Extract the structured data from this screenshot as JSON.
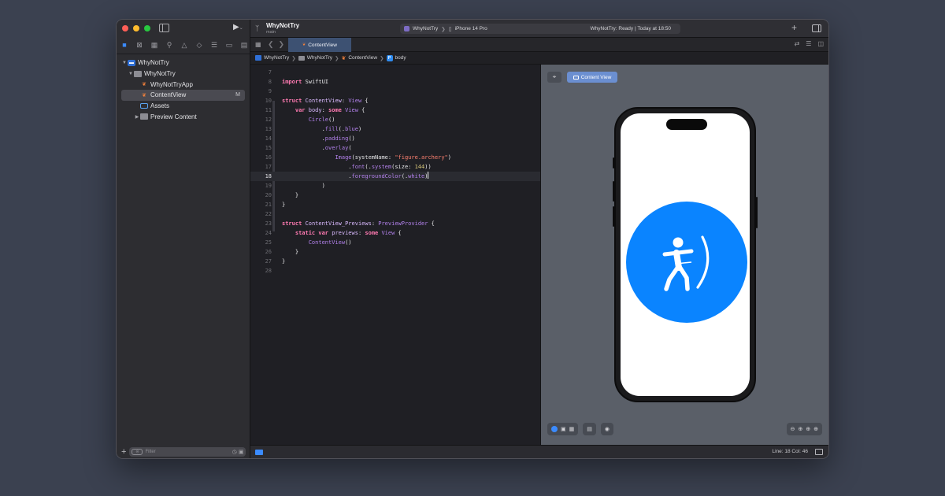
{
  "project": {
    "name": "WhyNotTry",
    "branch": "main"
  },
  "toolbar": {
    "run_glyph": "▶",
    "run_chevron": "⌄",
    "scheme_target": "WhyNotTry",
    "scheme_device": "iPhone 14 Pro",
    "status": "WhyNotTry: Ready | Today at 18:50",
    "add_glyph": "+"
  },
  "navigator": {
    "tree": [
      {
        "label": "WhyNotTry",
        "icon": "project-icon",
        "level": 0,
        "expanded": true
      },
      {
        "label": "WhyNotTry",
        "icon": "folder-icon",
        "level": 1,
        "expanded": true
      },
      {
        "label": "WhyNotTryApp",
        "icon": "swift-file-icon",
        "level": 2
      },
      {
        "label": "ContentView",
        "icon": "swift-file-icon",
        "level": 2,
        "selected": true,
        "badge": "M"
      },
      {
        "label": "Assets",
        "icon": "asset-catalog-icon",
        "level": 2
      },
      {
        "label": "Preview Content",
        "icon": "folder-icon",
        "level": 2,
        "expanded": false
      }
    ],
    "filter_placeholder": "Filter",
    "add_glyph": "+"
  },
  "tabs": [
    {
      "label": "ContentView",
      "active": true
    }
  ],
  "jumpbar": [
    "WhyNotTry",
    "WhyNotTry",
    "ContentView",
    "body"
  ],
  "editor": {
    "current_line": 18,
    "line_numbers": [
      "7",
      "8",
      "9",
      "10",
      "11",
      "12",
      "13",
      "14",
      "15",
      "16",
      "17",
      "18",
      "19",
      "20",
      "21",
      "22",
      "23",
      "24",
      "25",
      "26",
      "27",
      "28"
    ]
  },
  "canvas": {
    "pin_glyph": "⌖",
    "preview_button": "Content View",
    "symbol": "figure.archery",
    "circle_color": "#0a84ff"
  },
  "statusbar": {
    "position": "Line: 18  Col: 46"
  },
  "colors": {
    "accent": "#3b8bff",
    "swift": "#f0803c",
    "keyword": "#ff7ab2",
    "string": "#ff8170"
  }
}
